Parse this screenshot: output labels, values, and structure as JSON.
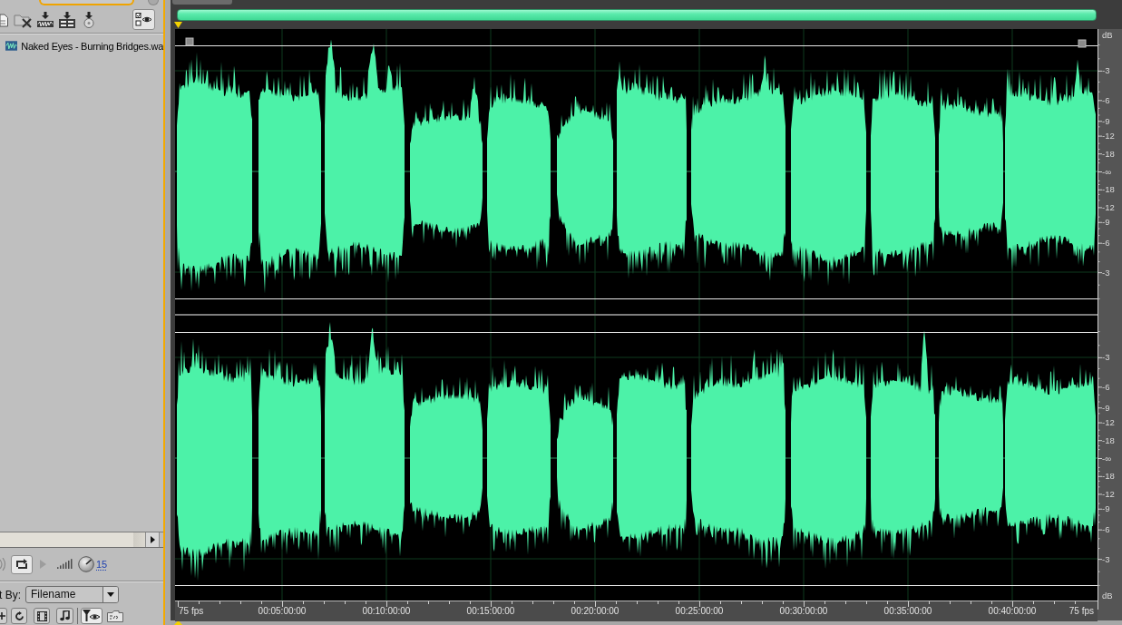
{
  "file_panel": {
    "files": [
      {
        "name": "Naked Eyes - Burning Bridges.wa",
        "selected": false
      }
    ],
    "play_button": {
      "disabled": true
    },
    "volume": "15",
    "sort": {
      "label": "t By:",
      "value": "Filename"
    }
  },
  "waveform_editor": {
    "db_unit_top": "dB",
    "channels": [
      {
        "db_labels": [
          "-3",
          "-6",
          "-9",
          "-12",
          "-18",
          "-∞",
          "-18",
          "-12",
          "-9",
          "-6",
          "-3"
        ]
      },
      {
        "db_labels": [
          "-3",
          "-6",
          "-9",
          "-12",
          "-18",
          "-∞",
          "-18",
          "-12",
          "-9",
          "-6",
          "-3"
        ]
      }
    ],
    "db_unit_bottom": "dB",
    "time_ruler": {
      "start_label": "75 fps",
      "labels": [
        "00:05:00:00",
        "00:10:00:00",
        "00:15:00:00",
        "00:20:00:00",
        "00:25:00:00",
        "00:30:00:00",
        "00:35:00:00",
        "00:40:00:00"
      ],
      "end_label": "75 fps"
    }
  }
}
